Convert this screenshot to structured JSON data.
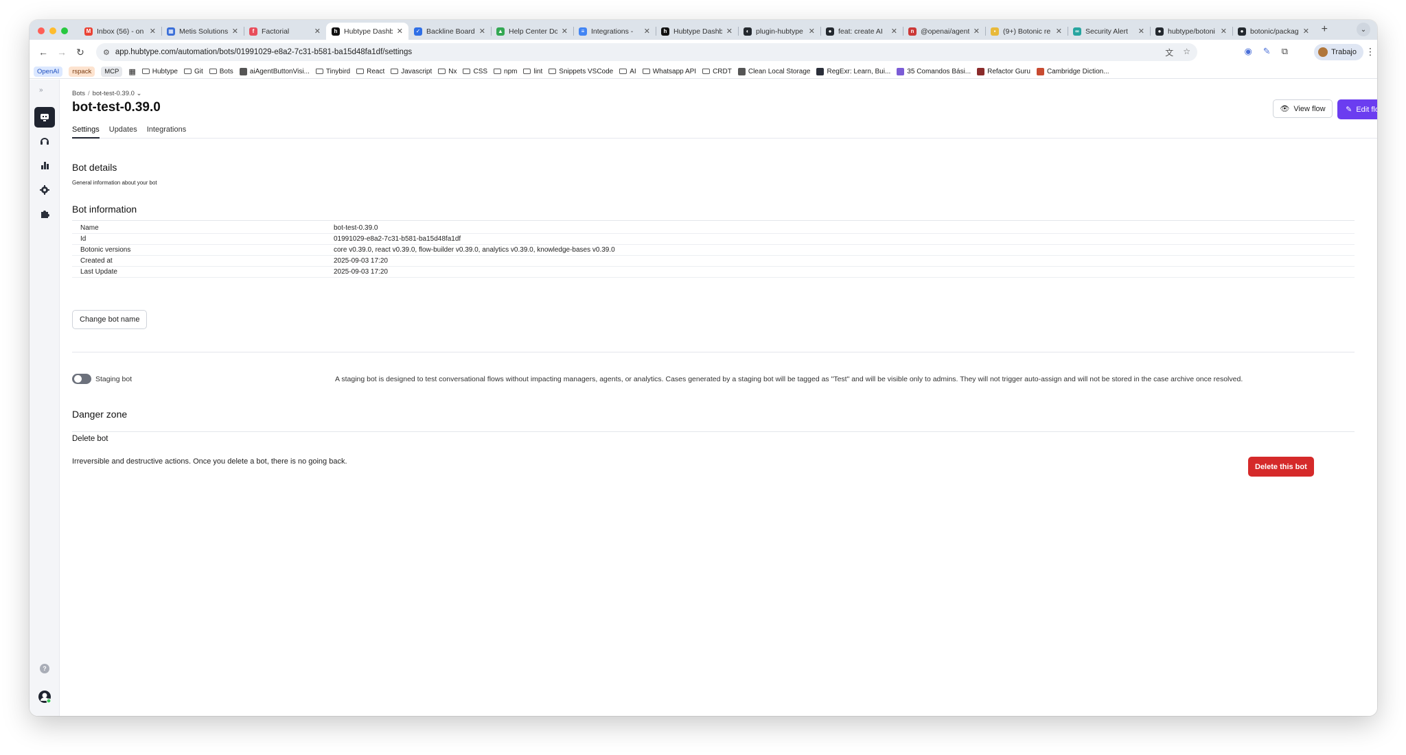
{
  "browser": {
    "tabs": [
      {
        "title": "Inbox (56) - on",
        "fav_color": "#ea4335",
        "fav_glyph": "M",
        "active": false
      },
      {
        "title": "Metis Solutions",
        "fav_color": "#3b6fd8",
        "fav_glyph": "▦",
        "active": false
      },
      {
        "title": "Factorial",
        "fav_color": "#e84d5b",
        "fav_glyph": "f",
        "active": false
      },
      {
        "title": "Hubtype Dashb",
        "fav_color": "#111111",
        "fav_glyph": "h",
        "active": true
      },
      {
        "title": "Backline Board",
        "fav_color": "#2f6fe6",
        "fav_glyph": "✓",
        "active": false
      },
      {
        "title": "Help Center Do",
        "fav_color": "#34a853",
        "fav_glyph": "▲",
        "active": false
      },
      {
        "title": "Integrations - ",
        "fav_color": "#4285f4",
        "fav_glyph": "≡",
        "active": false
      },
      {
        "title": "Hubtype Dashb",
        "fav_color": "#111111",
        "fav_glyph": "h",
        "active": false
      },
      {
        "title": "plugin-hubtype",
        "fav_color": "#24292f",
        "fav_glyph": "◐",
        "active": false
      },
      {
        "title": "feat: create AI",
        "fav_color": "#24292f",
        "fav_glyph": "●",
        "active": false
      },
      {
        "title": "@openai/agent",
        "fav_color": "#cb3837",
        "fav_glyph": "n",
        "active": false
      },
      {
        "title": "(9+) Botonic re",
        "fav_color": "#e8b93a",
        "fav_glyph": "▪",
        "active": false
      },
      {
        "title": "Security Alert ",
        "fav_color": "#27a5a0",
        "fav_glyph": "∞",
        "active": false
      },
      {
        "title": "hubtype/botoni",
        "fav_color": "#24292f",
        "fav_glyph": "●",
        "active": false
      },
      {
        "title": "botonic/packag",
        "fav_color": "#24292f",
        "fav_glyph": "●",
        "active": false
      }
    ],
    "new_tab": "+",
    "url": "app.hubtype.com/automation/bots/01991029-e8a2-7c31-b581-ba15d48fa1df/settings",
    "profile_label": "Trabajo",
    "bookmarks": [
      {
        "label": "OpenAI",
        "kind": "chip",
        "color": "#dce8ff",
        "text_color": "#1f4fbf"
      },
      {
        "label": "rspack",
        "kind": "chip",
        "color": "#fde3cf",
        "text_color": "#7a3b10"
      },
      {
        "label": "MCP",
        "kind": "chip",
        "color": "#e6e8ec",
        "text_color": "#222222"
      },
      {
        "label": "",
        "kind": "grid"
      },
      {
        "label": "Hubtype",
        "kind": "folder"
      },
      {
        "label": "Git",
        "kind": "folder"
      },
      {
        "label": "Bots",
        "kind": "folder"
      },
      {
        "label": "aiAgentButtonVisi...",
        "kind": "site",
        "color": "#555555"
      },
      {
        "label": "Tinybird",
        "kind": "folder"
      },
      {
        "label": "React",
        "kind": "folder"
      },
      {
        "label": "Javascript",
        "kind": "folder"
      },
      {
        "label": "Nx",
        "kind": "folder"
      },
      {
        "label": "CSS",
        "kind": "folder"
      },
      {
        "label": "npm",
        "kind": "folder"
      },
      {
        "label": "lint",
        "kind": "folder"
      },
      {
        "label": "Snippets VSCode",
        "kind": "folder"
      },
      {
        "label": "AI",
        "kind": "folder"
      },
      {
        "label": "Whatsapp API",
        "kind": "folder"
      },
      {
        "label": "CRDT",
        "kind": "folder"
      },
      {
        "label": "Clean Local Storage",
        "kind": "site",
        "color": "#555555"
      },
      {
        "label": "RegExr: Learn, Bui...",
        "kind": "site",
        "color": "#2b2f3a"
      },
      {
        "label": "35 Comandos Bási...",
        "kind": "site",
        "color": "#7b5cd6"
      },
      {
        "label": "Refactor Guru",
        "kind": "site",
        "color": "#8a2b2b"
      },
      {
        "label": "Cambridge Diction...",
        "kind": "site",
        "color": "#c84b31"
      }
    ]
  },
  "page": {
    "breadcrumb": {
      "root": "Bots",
      "separator": "/",
      "current": "bot-test-0.39.0"
    },
    "title": "bot-test-0.39.0",
    "view_flow_label": "View flow",
    "edit_flow_label": "Edit flow",
    "tabs": [
      "Settings",
      "Updates",
      "Integrations"
    ],
    "active_tab": "Settings",
    "bot_details": {
      "heading": "Bot details",
      "description": "General information about your bot"
    },
    "bot_information": {
      "heading": "Bot information",
      "rows": [
        {
          "key": "Name",
          "value": "bot-test-0.39.0"
        },
        {
          "key": "Id",
          "value": "01991029-e8a2-7c31-b581-ba15d48fa1df"
        },
        {
          "key": "Botonic versions",
          "value": "core v0.39.0, react v0.39.0, flow-builder v0.39.0, analytics v0.39.0, knowledge-bases v0.39.0"
        },
        {
          "key": "Created at",
          "value": "2025-09-03 17:20"
        },
        {
          "key": "Last Update",
          "value": "2025-09-03 17:20"
        }
      ],
      "change_name_label": "Change bot name"
    },
    "staging": {
      "label": "Staging bot",
      "enabled": false,
      "description": "A staging bot is designed to test conversational flows without impacting managers, agents, or analytics. Cases generated by a staging bot will be tagged as \"Test\" and will be visible only to admins. They will not trigger auto-assign and will not be stored in the case archive once resolved."
    },
    "danger": {
      "heading": "Danger zone",
      "subheading": "Delete bot",
      "description": "Irreversible and destructive actions. Once you delete a bot, there is no going back.",
      "delete_label": "Delete this bot"
    }
  },
  "colors": {
    "primary": "#6b3df0",
    "danger": "#d52a2a",
    "sidebar_active": "#1f2430"
  }
}
